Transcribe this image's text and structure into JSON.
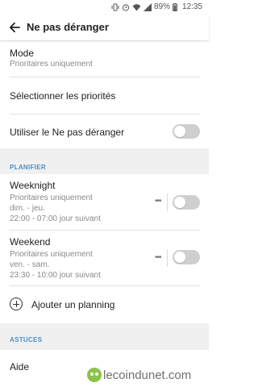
{
  "status_bar": {
    "battery": "89%",
    "time": "12:35",
    "icons": [
      "vibrate-icon",
      "alarm-icon",
      "wifi-icon",
      "signal-icon",
      "battery-icon"
    ]
  },
  "app_bar": {
    "title": "Ne pas déranger",
    "back_icon": "arrow-back-icon"
  },
  "mode": {
    "title": "Mode",
    "value": "Prioritaires uniquement"
  },
  "priorities": {
    "title": "Sélectionner les priorités"
  },
  "use_dnd": {
    "title": "Utiliser le Ne pas déranger",
    "enabled": false
  },
  "planifier": {
    "header": "PLANIFIER",
    "schedules": [
      {
        "name": "Weeknight",
        "mode": "Prioritaires uniquement",
        "days": "dim. - jeu.",
        "time": "22:00 - 07:00 jour suivant",
        "enabled": false
      },
      {
        "name": "Weekend",
        "mode": "Prioritaires uniquement",
        "days": "ven. - sam.",
        "time": "23:30 - 10:00 jour suivant",
        "enabled": false
      }
    ],
    "add_label": "Ajouter un planning"
  },
  "astuces": {
    "header": "ASTUCES",
    "help_label": "Aide"
  },
  "watermark": {
    "text": "lecoindunet.com"
  },
  "colors": {
    "accent": "#4a90c8",
    "toggle_off": "#cfcfcf",
    "section_band": "#f0f0f0",
    "watermark_green": "#8bc34a"
  }
}
